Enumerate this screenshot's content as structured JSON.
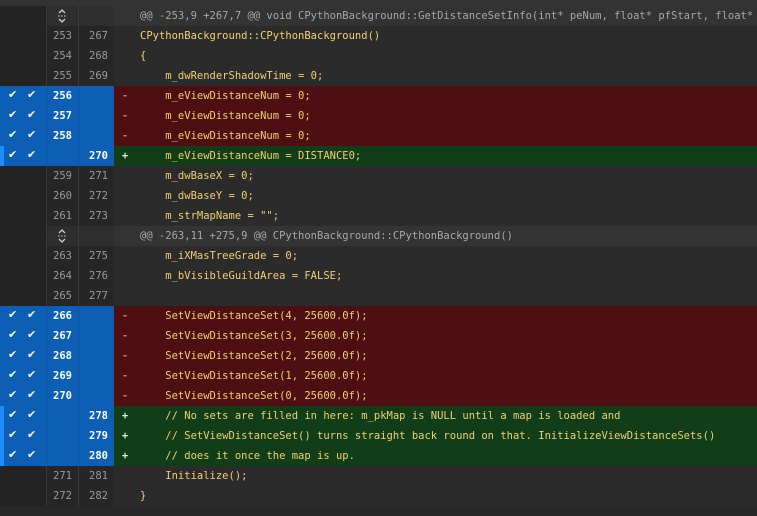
{
  "colors": {
    "selection": "#0d5fb6",
    "deleted_bg": "#4d0f12",
    "added_bg": "#123d19",
    "context_bg": "#2b2b2b",
    "hunk_bg": "#333333"
  },
  "icons": {
    "expand": "expand-context-icon",
    "check": "checkmark-icon"
  },
  "rows": [
    {
      "type": "hunk",
      "old": "",
      "new": "",
      "sign": "",
      "code": "@@ -253,9 +267,7 @@ void CPythonBackground::GetDistanceSetInfo(int* peNum, float* pfStart, float* pf",
      "selected": false
    },
    {
      "type": "ctx",
      "old": "253",
      "new": "267",
      "sign": "",
      "code": "CPythonBackground::CPythonBackground()",
      "selected": false
    },
    {
      "type": "ctx",
      "old": "254",
      "new": "268",
      "sign": "",
      "code": "{",
      "selected": false
    },
    {
      "type": "ctx",
      "old": "255",
      "new": "269",
      "sign": "",
      "code": "    m_dwRenderShadowTime = 0;",
      "selected": false
    },
    {
      "type": "del",
      "old": "256",
      "new": "",
      "sign": "-",
      "code": "    m_eViewDistanceNum = 0;",
      "selected": true
    },
    {
      "type": "del",
      "old": "257",
      "new": "",
      "sign": "-",
      "code": "    m_eViewDistanceNum = 0;",
      "selected": true
    },
    {
      "type": "del",
      "old": "258",
      "new": "",
      "sign": "-",
      "code": "    m_eViewDistanceNum = 0;",
      "selected": true
    },
    {
      "type": "add",
      "old": "",
      "new": "270",
      "sign": "+",
      "code": "    m_eViewDistanceNum = DISTANCE0;",
      "selected": true
    },
    {
      "type": "ctx",
      "old": "259",
      "new": "271",
      "sign": "",
      "code": "    m_dwBaseX = 0;",
      "selected": false
    },
    {
      "type": "ctx",
      "old": "260",
      "new": "272",
      "sign": "",
      "code": "    m_dwBaseY = 0;",
      "selected": false
    },
    {
      "type": "ctx",
      "old": "261",
      "new": "273",
      "sign": "",
      "code": "    m_strMapName = \"\";",
      "selected": false
    },
    {
      "type": "hunk",
      "old": "",
      "new": "",
      "sign": "",
      "code": "@@ -263,11 +275,9 @@ CPythonBackground::CPythonBackground()",
      "selected": false
    },
    {
      "type": "ctx",
      "old": "263",
      "new": "275",
      "sign": "",
      "code": "    m_iXMasTreeGrade = 0;",
      "selected": false
    },
    {
      "type": "ctx",
      "old": "264",
      "new": "276",
      "sign": "",
      "code": "    m_bVisibleGuildArea = FALSE;",
      "selected": false
    },
    {
      "type": "ctx",
      "old": "265",
      "new": "277",
      "sign": "",
      "code": "",
      "selected": false
    },
    {
      "type": "del",
      "old": "266",
      "new": "",
      "sign": "-",
      "code": "    SetViewDistanceSet(4, 25600.0f);",
      "selected": true
    },
    {
      "type": "del",
      "old": "267",
      "new": "",
      "sign": "-",
      "code": "    SetViewDistanceSet(3, 25600.0f);",
      "selected": true
    },
    {
      "type": "del",
      "old": "268",
      "new": "",
      "sign": "-",
      "code": "    SetViewDistanceSet(2, 25600.0f);",
      "selected": true
    },
    {
      "type": "del",
      "old": "269",
      "new": "",
      "sign": "-",
      "code": "    SetViewDistanceSet(1, 25600.0f);",
      "selected": true
    },
    {
      "type": "del",
      "old": "270",
      "new": "",
      "sign": "-",
      "code": "    SetViewDistanceSet(0, 25600.0f);",
      "selected": true
    },
    {
      "type": "add",
      "old": "",
      "new": "278",
      "sign": "+",
      "code": "    // No sets are filled in here: m_pkMap is NULL until a map is loaded and",
      "selected": true
    },
    {
      "type": "add",
      "old": "",
      "new": "279",
      "sign": "+",
      "code": "    // SetViewDistanceSet() turns straight back round on that. InitializeViewDistanceSets()",
      "selected": true
    },
    {
      "type": "add",
      "old": "",
      "new": "280",
      "sign": "+",
      "code": "    // does it once the map is up.",
      "selected": true
    },
    {
      "type": "ctx",
      "old": "271",
      "new": "281",
      "sign": "",
      "code": "    Initialize();",
      "selected": false
    },
    {
      "type": "ctx",
      "old": "272",
      "new": "282",
      "sign": "",
      "code": "}",
      "selected": false
    }
  ]
}
